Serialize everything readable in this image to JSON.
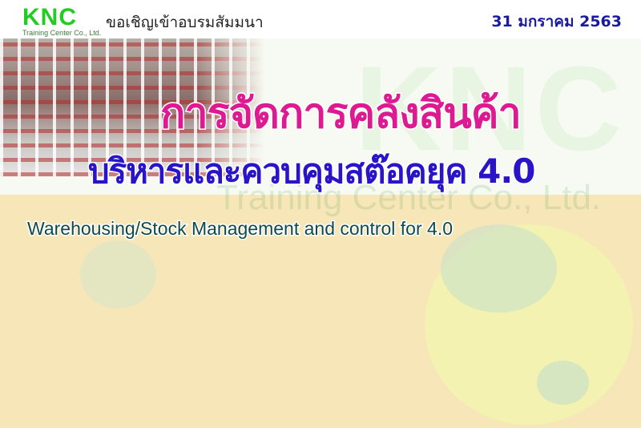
{
  "header": {
    "logo_text": "KNC",
    "logo_subtitle": "Training Center Co., Ltd.",
    "invite": "ขอเชิญเข้าอบรมสัมมนา",
    "date": "31 มกราคม 2563"
  },
  "banner": {
    "title_th": "การจัดการคลังสินค้า",
    "subtitle_th": "บริหารและควบคุมสต๊อคยุค 4.0",
    "title_en": "Warehousing/Stock Management and control for 4.0",
    "watermark": "KNC",
    "watermark_sub": "Training Center Co., Ltd."
  },
  "colors": {
    "brand_green": "#22cc22",
    "title_pink": "#dd1a92",
    "subtitle_blue": "#2a14c8",
    "date_blue": "#1a1aa0",
    "background": "#f7e6b8"
  }
}
